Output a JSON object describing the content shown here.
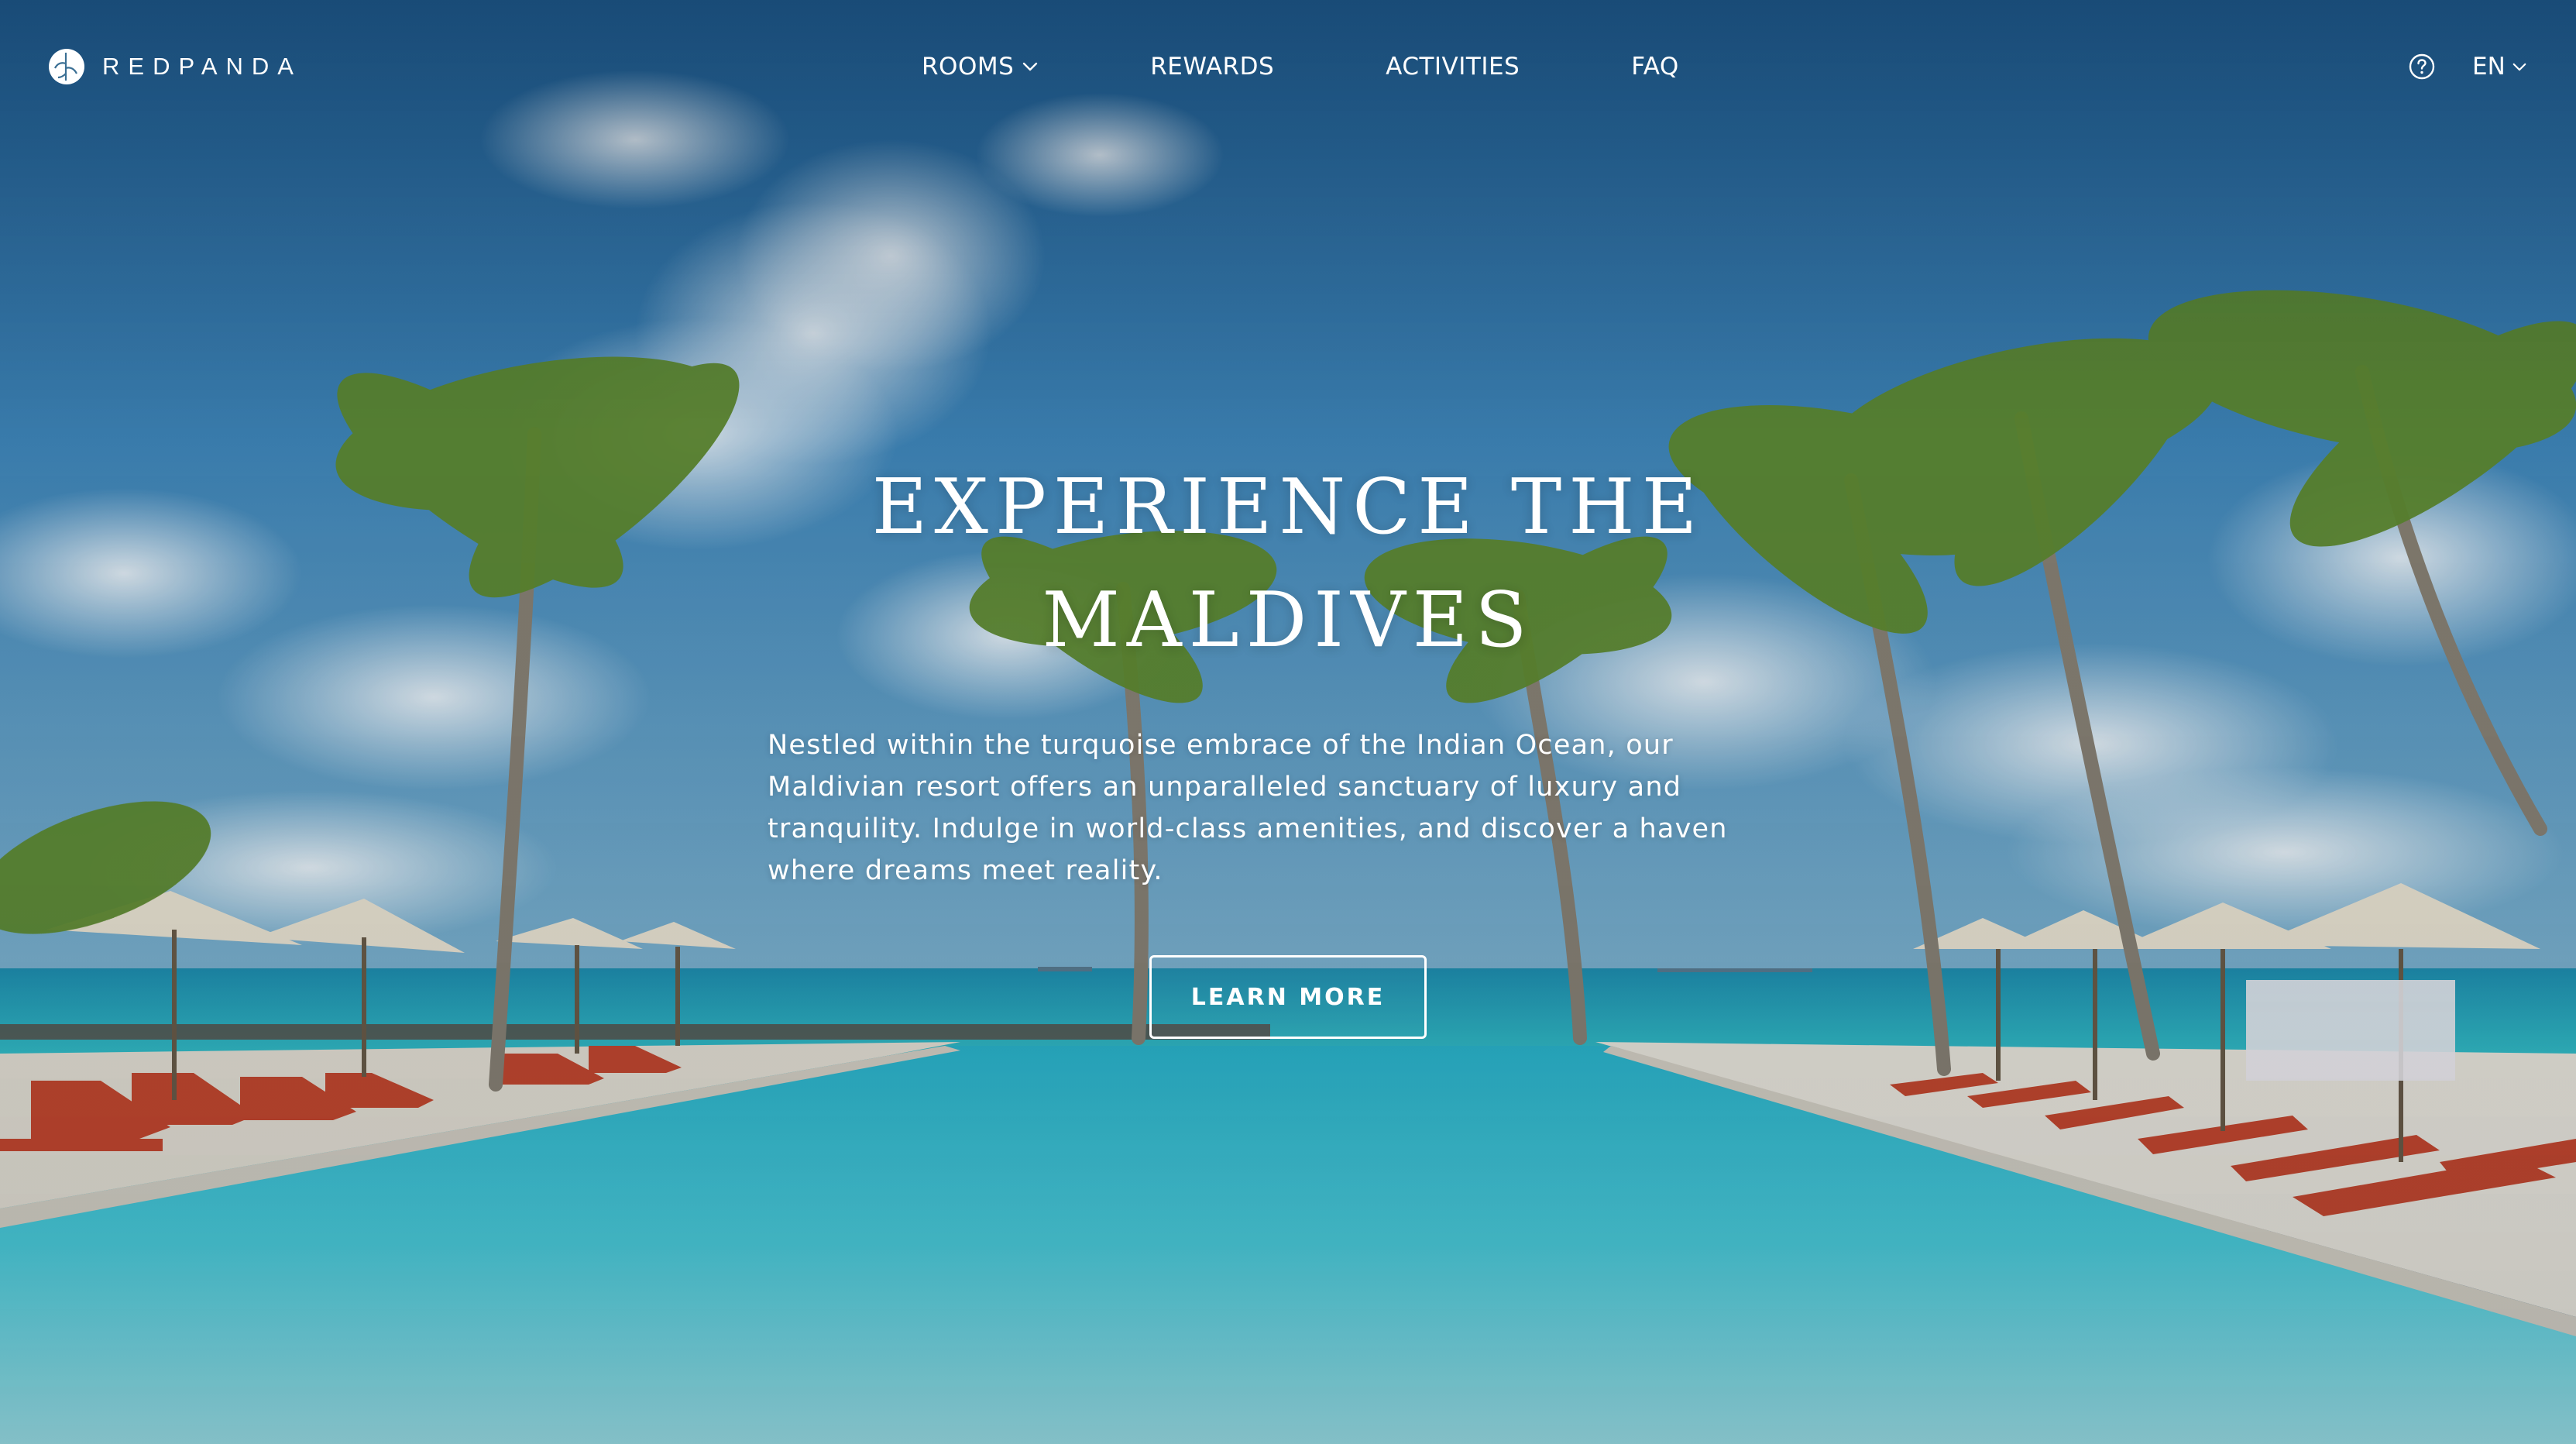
{
  "brand": {
    "name": "REDPANDA",
    "logo_icon": "redpanda-leaf-logo-icon"
  },
  "nav": {
    "items": [
      {
        "label": "ROOMS",
        "has_dropdown": true
      },
      {
        "label": "REWARDS",
        "has_dropdown": false
      },
      {
        "label": "ACTIVITIES",
        "has_dropdown": false
      },
      {
        "label": "FAQ",
        "has_dropdown": false
      }
    ]
  },
  "utility": {
    "help_icon": "help-circle-icon",
    "language": "EN"
  },
  "hero": {
    "title": "EXPERIENCE THE MALDIVES",
    "description": "Nestled within the turquoise embrace of the Indian Ocean, our Maldivian resort offers an unparalleled sanctuary of luxury and tranquility. Indulge in world-class amenities, and discover a haven where dreams meet reality.",
    "cta_label": "LEARN MORE",
    "background": "maldives-infinity-pool-palm-beach-photo"
  },
  "colors": {
    "text": "#ffffff",
    "sky": "#2f6fa6",
    "sea": "#2fbcc8",
    "pool": "#55d4de",
    "lounger": "#c8452a"
  }
}
